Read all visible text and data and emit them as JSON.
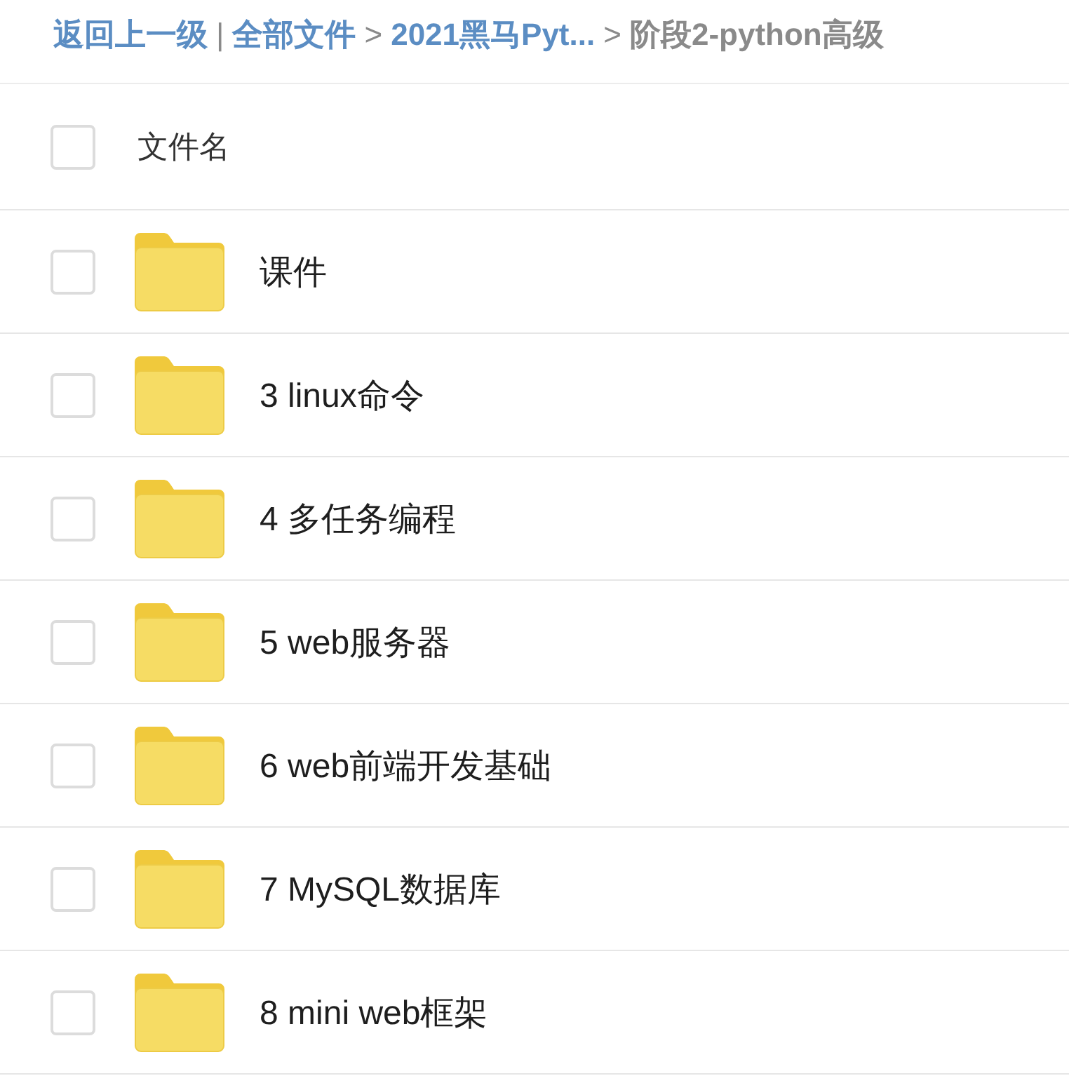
{
  "breadcrumb": [
    {
      "kind": "link",
      "text": "返回上一级"
    },
    {
      "kind": "separator",
      "text": "|"
    },
    {
      "kind": "link",
      "text": "全部文件"
    },
    {
      "kind": "arrow",
      "text": ">"
    },
    {
      "kind": "link",
      "text": "2021黑马Pyt..."
    },
    {
      "kind": "arrow",
      "text": ">"
    },
    {
      "kind": "current",
      "text": "阶段2-python高级"
    }
  ],
  "header": {
    "label": "文件名",
    "checked": false
  },
  "files": [
    {
      "name": "课件",
      "checked": false
    },
    {
      "name": "3 linux命令",
      "checked": false
    },
    {
      "name": "4 多任务编程",
      "checked": false
    },
    {
      "name": "5 web服务器",
      "checked": false
    },
    {
      "name": "6 web前端开发基础",
      "checked": false
    },
    {
      "name": "7 MySQL数据库",
      "checked": false
    },
    {
      "name": "8 mini web框架",
      "checked": false
    }
  ]
}
